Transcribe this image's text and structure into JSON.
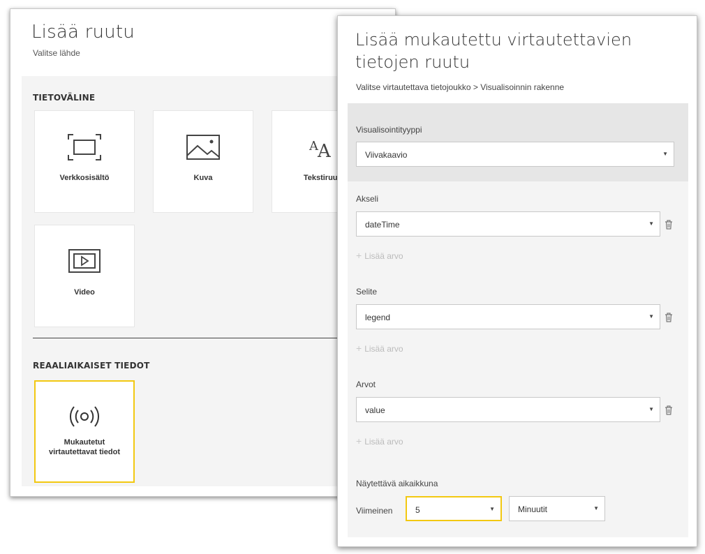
{
  "back_dialog": {
    "title": "Lisää ruutu",
    "subtitle": "Valitse lähde",
    "media_section": {
      "title": "TIETOVÄLINE",
      "tiles": [
        {
          "label": "Verkkosisältö",
          "icon": "web-content-icon"
        },
        {
          "label": "Kuva",
          "icon": "image-icon"
        },
        {
          "label": "Tekstiruut",
          "icon": "text-box-icon"
        },
        {
          "label": "Video",
          "icon": "video-icon"
        }
      ]
    },
    "realtime_section": {
      "title": "REAALIAIKAISET TIEDOT",
      "tiles": [
        {
          "label": "Mukautetut virtautettavat tiedot",
          "icon": "streaming-icon",
          "selected": true
        }
      ]
    }
  },
  "front_dialog": {
    "title": "Lisää mukautettu virtautettavien tietojen ruutu",
    "breadcrumb": "Valitse virtautettava tietojoukko > Visualisoinnin rakenne",
    "visualization": {
      "label": "Visualisointityyppi",
      "value": "Viivakaavio"
    },
    "axis": {
      "label": "Akseli",
      "value": "dateTime",
      "add_label": "Lisää arvo"
    },
    "legend": {
      "label": "Selite",
      "value": "legend",
      "add_label": "Lisää arvo"
    },
    "values": {
      "label": "Arvot",
      "value": "value",
      "add_label": "Lisää arvo"
    },
    "time_window": {
      "label": "Näytettävä aikaikkuna",
      "prefix": "Viimeinen",
      "amount": "5",
      "unit": "Minuutit"
    }
  },
  "colors": {
    "accent": "#f2c811",
    "panel_bg": "#f4f4f4",
    "vis_bg": "#e6e6e6"
  },
  "arrow_glyph": "▼",
  "plus_glyph": "+"
}
